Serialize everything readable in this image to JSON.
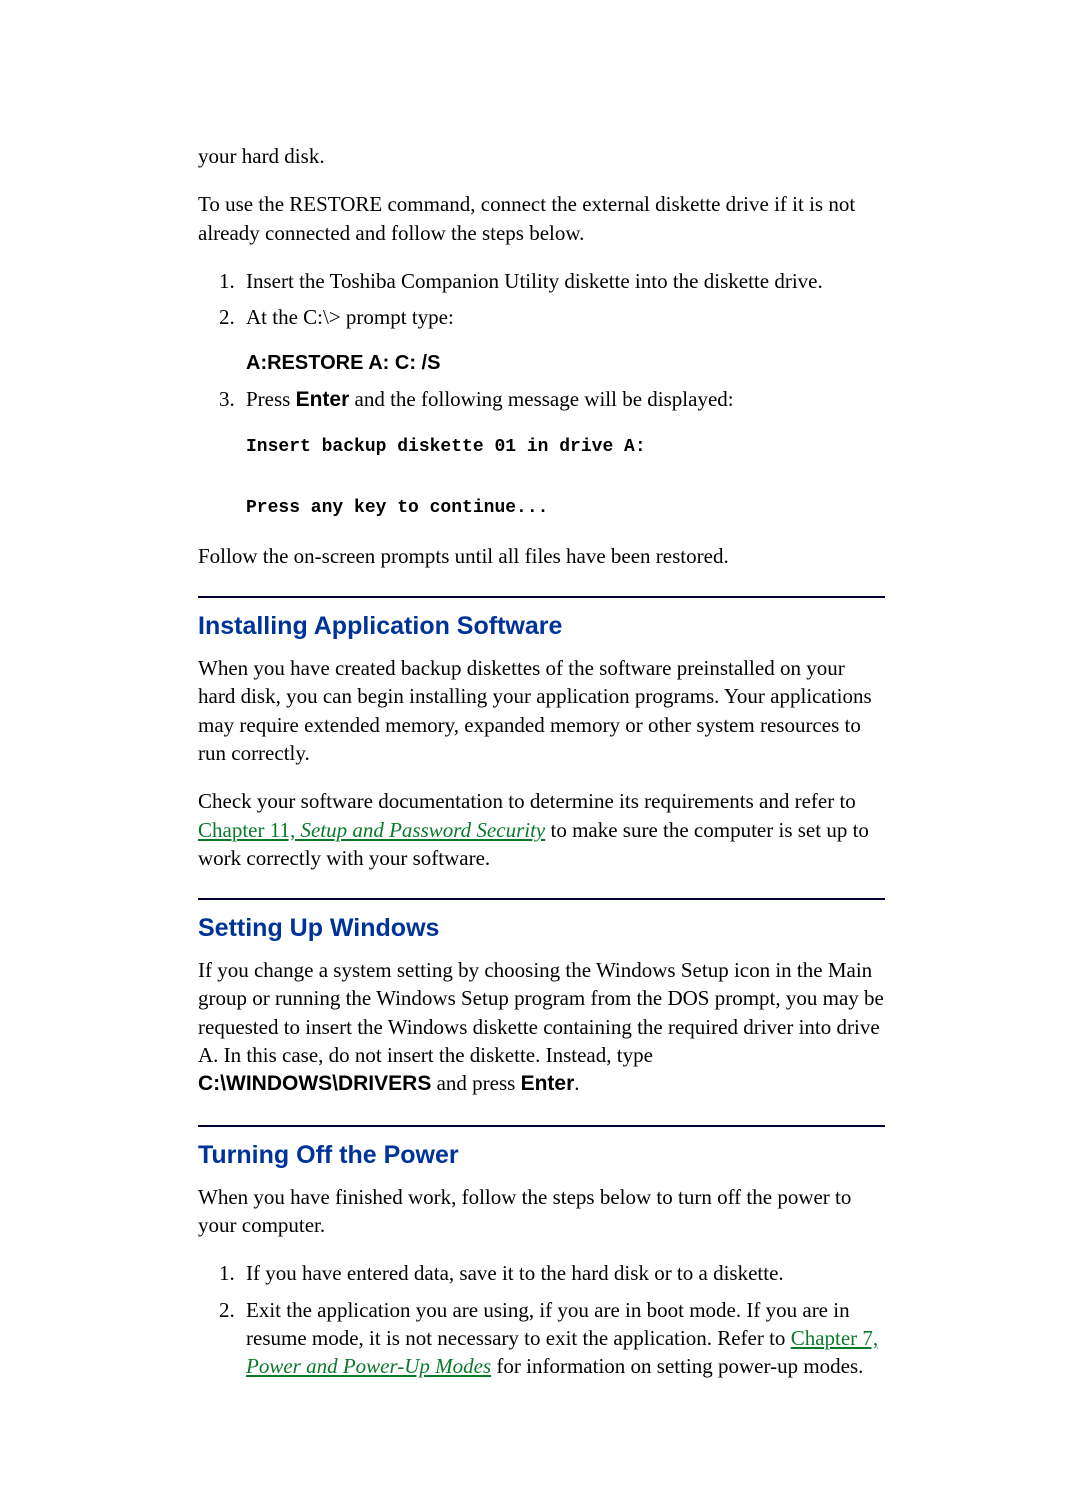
{
  "intro1": "your hard disk.",
  "intro2": "To use the RESTORE command, connect the external diskette drive if it is not already connected and follow the steps below.",
  "list1": {
    "item1": "Insert the Toshiba Companion Utility diskette into the diskette drive.",
    "item2": "At the C:\\> prompt type:",
    "cmd": "A:RESTORE A: C: /S",
    "item3_pre": "Press ",
    "item3_enter": "Enter",
    "item3_post": " and the following message will be displayed:",
    "code": "Insert backup diskette 01 in drive A:\n\nPress any key to continue..."
  },
  "follow": "Follow the on-screen prompts until all files have been restored.",
  "install": {
    "heading": "Installing Application Software",
    "p1": "When you have created backup diskettes of the software preinstalled on your hard disk, you can begin installing your application programs. Your applications may require extended memory, expanded memory or other system resources to run correctly.",
    "p2_pre": "Check your software documentation to determine its requirements and refer to ",
    "link_plain": "Chapter 11, ",
    "link_italic": "Setup and Password Security",
    "p2_post": " to make sure the computer is set up to work correctly with your software."
  },
  "windows": {
    "heading": "Setting Up Windows",
    "p1_pre": "If you change a system setting by choosing the Windows Setup icon in the Main group or running the Windows Setup program from the DOS prompt, you may be requested to insert the Windows diskette containing the required driver into drive A. In this case, do not insert the diskette. Instead, type ",
    "path": "C:\\WINDOWS\\DRIVERS",
    "p1_mid": " and press ",
    "enter": "Enter",
    "p1_post": "."
  },
  "poweroff": {
    "heading": "Turning Off the Power",
    "intro": "When you have finished work, follow the steps below to turn off the power to your computer.",
    "item1": "If you have entered data, save it to the hard disk or to a diskette.",
    "item2_pre": "Exit the application you are using, if you are in boot mode. If you are in resume mode, it is not necessary to exit the application. Refer to ",
    "link_plain": "Chapter 7, ",
    "link_italic": "Power and Power-Up Modes",
    "item2_post": " for information on setting power-up modes."
  }
}
